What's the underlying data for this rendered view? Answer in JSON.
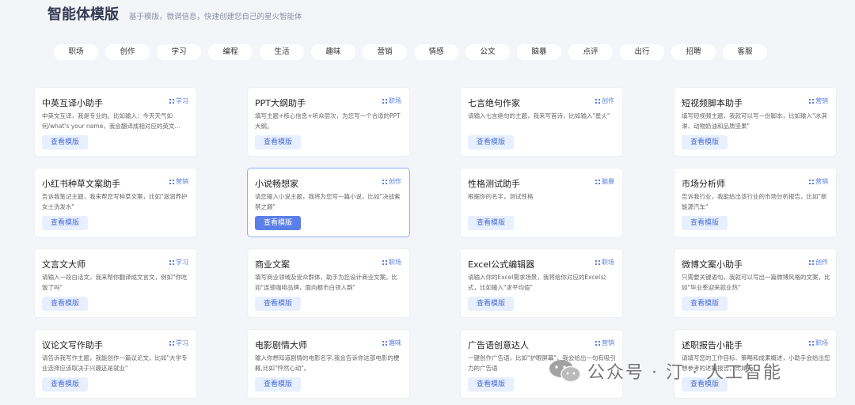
{
  "header": {
    "title": "智能体模版",
    "subtitle": "基于模版，微调信息，快速创建您自己的星火智能体"
  },
  "categories": [
    "职场",
    "创作",
    "学习",
    "编程",
    "生活",
    "趣味",
    "营销",
    "情感",
    "公文",
    "脑暴",
    "点评",
    "出行",
    "招聘",
    "客服"
  ],
  "button_label": "查看模版",
  "cards": [
    {
      "title": "中英互译小助手",
      "tag": "学习",
      "desc": "中英文互译，我是专业的。比如输入：今天天气如何/what's your name，我会翻译成相对应的英文..."
    },
    {
      "title": "PPT大纲助手",
      "tag": "职场",
      "desc": "填写主题+核心信息+听众层次，为您写一个合适的PPT大纲。"
    },
    {
      "title": "七言绝句作家",
      "tag": "创作",
      "desc": "请输入七言绝句的主题，我来写首诗，比如输入\"星火\""
    },
    {
      "title": "短视频脚本助手",
      "tag": "营销",
      "desc": "填写短视频主题，我就可以写一份脚本，比如输入\"冰淇淋、动物奶油和品质坚果\""
    },
    {
      "title": "小红书种草文案助手",
      "tag": "营销",
      "desc": "告诉我笔记主题，我来帮您写种草文案，比如\"滋润养护女士洗发水\""
    },
    {
      "title": "小说畅想家",
      "tag": "创作",
      "desc": "请您输入小说主题，我将为您写一篇小说，比如\"决战紫禁之巅\""
    },
    {
      "title": "性格测试助手",
      "tag": "脑暴",
      "desc": "根据你的名字，测试性格"
    },
    {
      "title": "市场分析师",
      "tag": "营销",
      "desc": "告诉我行业，我能给出该行业的市场分析报告，比如\"新能源汽车\""
    },
    {
      "title": "文言文大师",
      "tag": "学习",
      "desc": "请输入一段白话文，我来帮你翻译成文言文，例如\"你吃饭了吗\""
    },
    {
      "title": "商业文案",
      "tag": "职场",
      "desc": "填写商业领域及受众群体，助手为您设计商业文案。比如\"连锁咖啡品牌，面向都市白领人群\""
    },
    {
      "title": "Excel公式编辑器",
      "tag": "职场",
      "desc": "请输入你的Excel需求场景，我将给你对应的Excel公式，比如输入\"求平均值\""
    },
    {
      "title": "微博文案小助手",
      "tag": "创作",
      "desc": "只需要关键语句，我就可以写出一篇微博风格的文案，比如\"毕业季迎来就业热\""
    },
    {
      "title": "议论文写作助手",
      "tag": "学习",
      "desc": "请告诉我写作主题，我能创作一篇议论文，比如\"大学专业选择应该取决于兴趣还是就业\""
    },
    {
      "title": "电影剧情大师",
      "tag": "趣味",
      "desc": "输入你想知道剧情的电影名字,我会告诉你这部电影的梗概,比如\"怦然心动\"。"
    },
    {
      "title": "广告语创意达人",
      "tag": "营销",
      "desc": "一键创作广告语，比如\"护眼屏幕\"，我会给出一句有吸引力的广告语"
    },
    {
      "title": "述职报告小能手",
      "tag": "职场",
      "desc": "请填写您的工作目标、策略和成果概述，小助手会给出您想参考的述职报告，比如\"..."
    }
  ],
  "watermark": "公众号 · 汀 · 人工智能"
}
